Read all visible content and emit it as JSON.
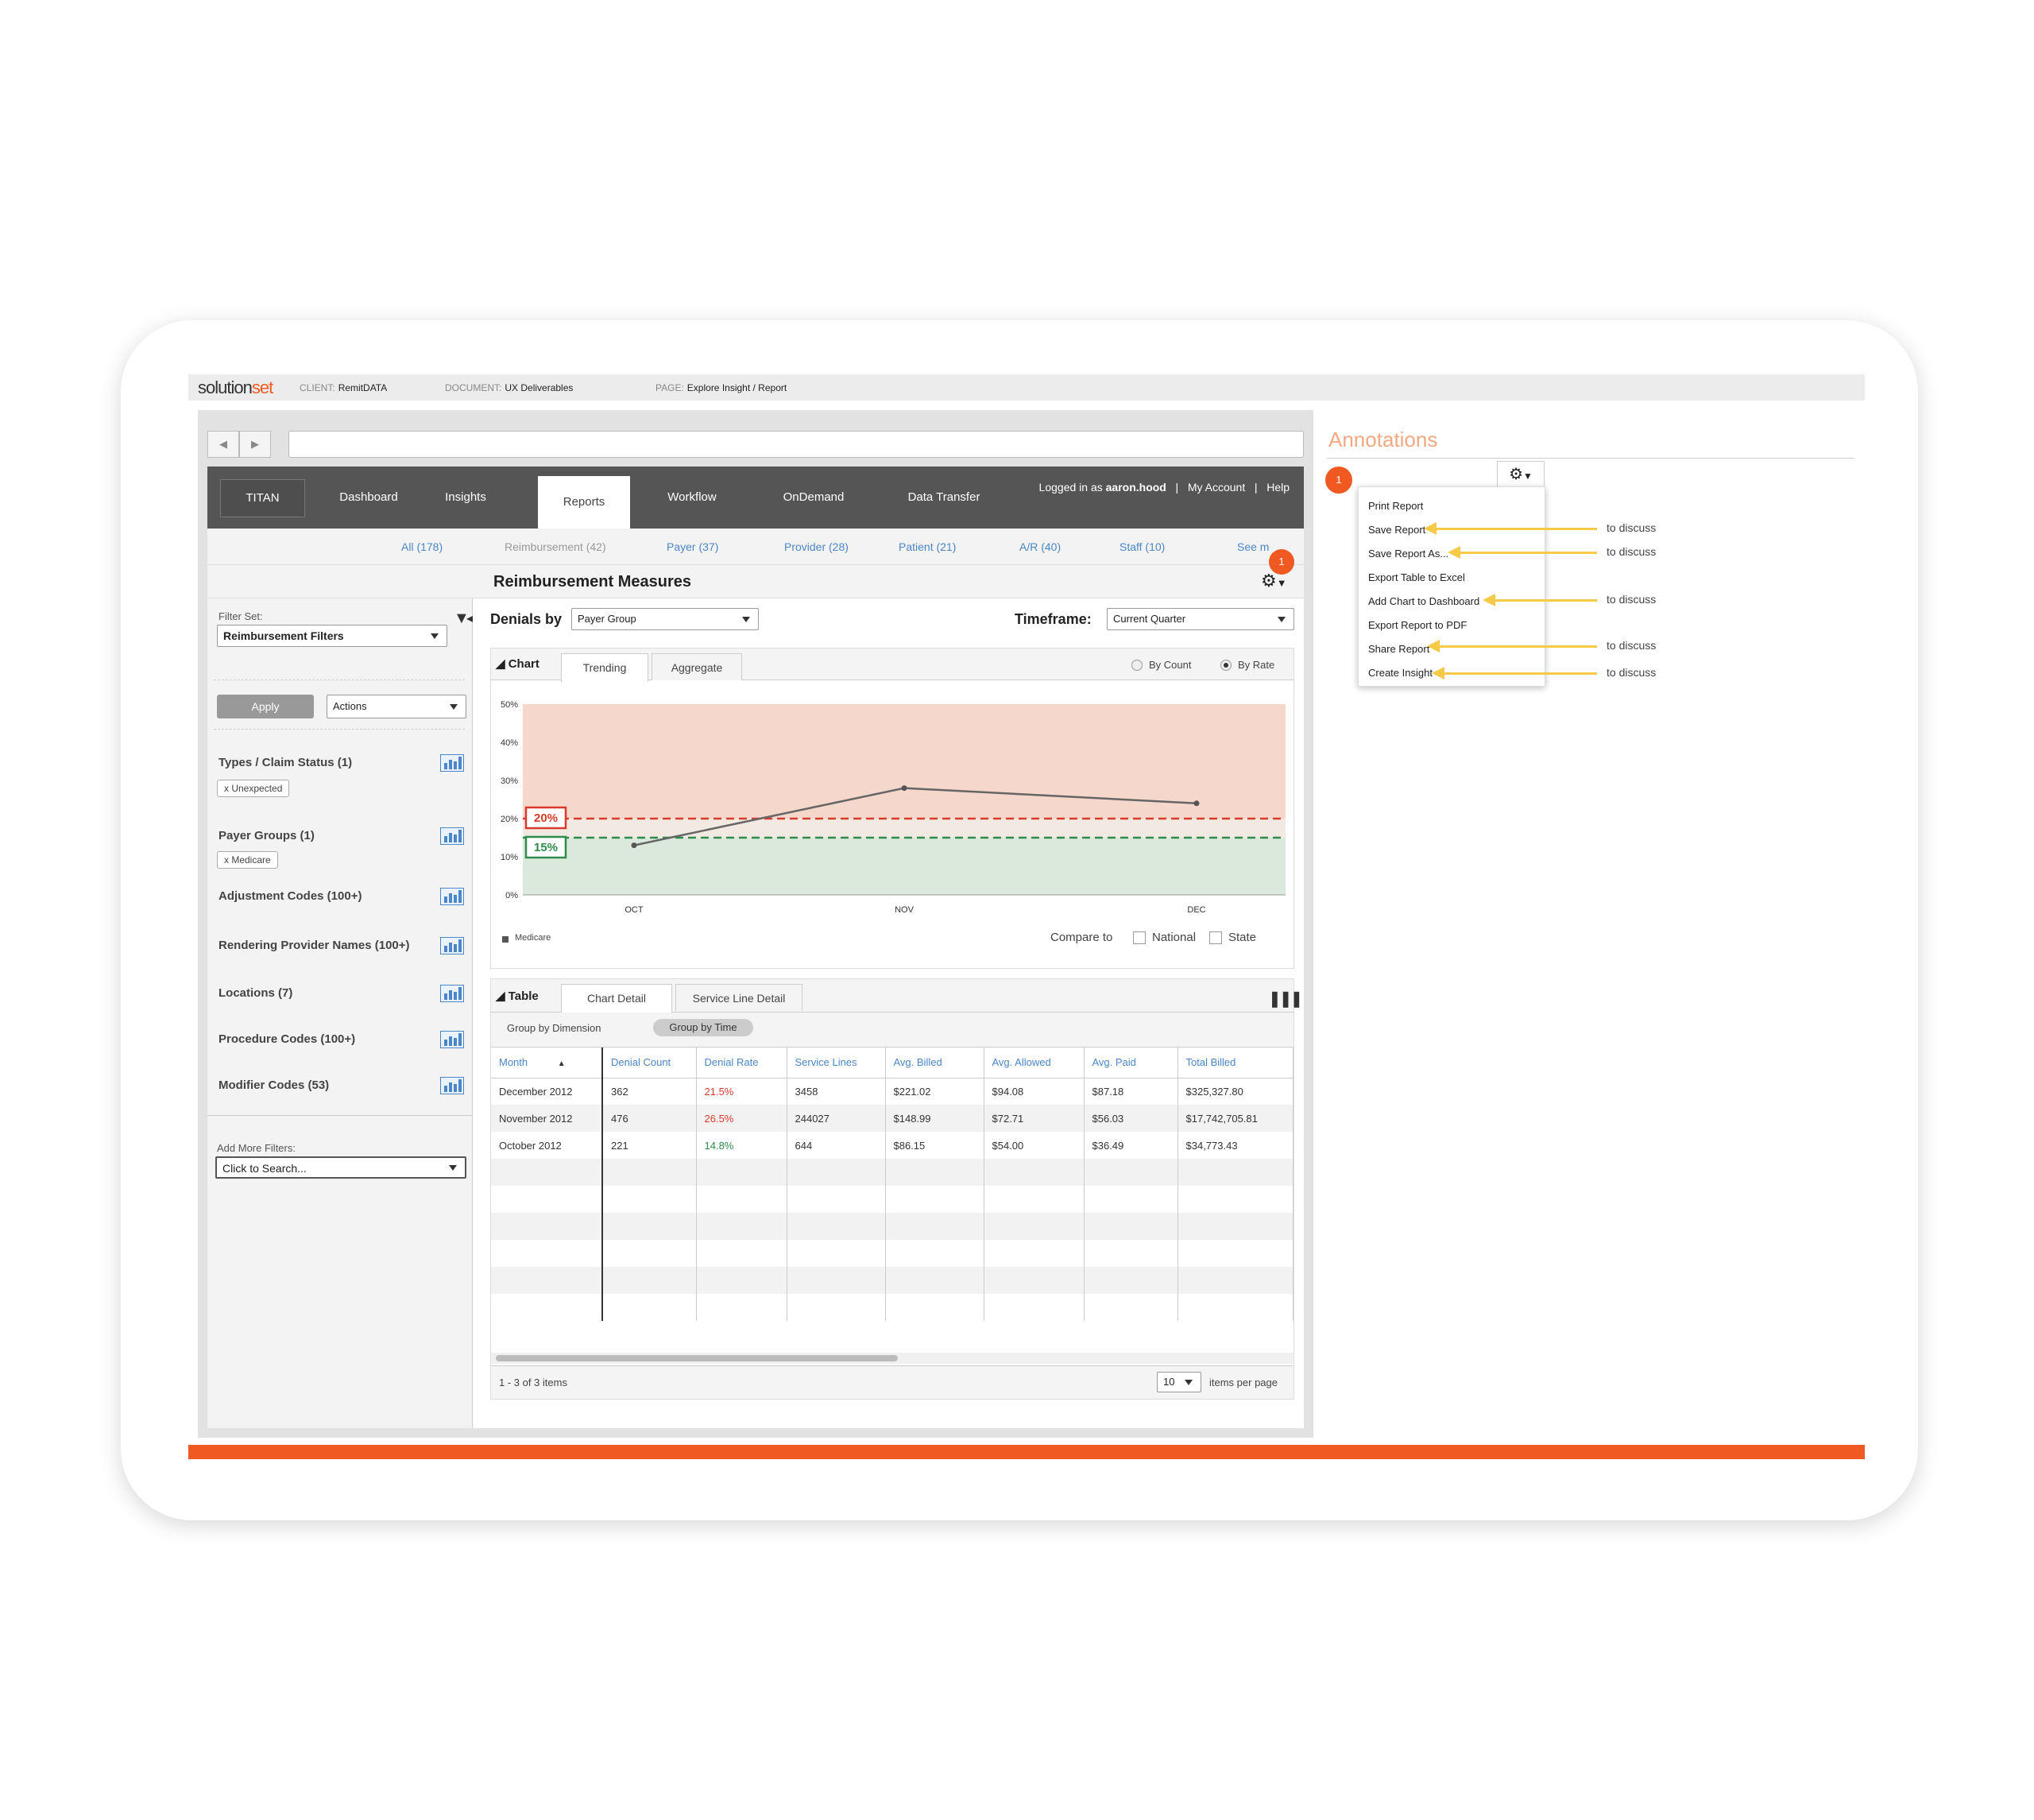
{
  "header": {
    "brand_a": "solution",
    "brand_b": "set",
    "client_key": "CLIENT:",
    "client_val": "RemitDATA",
    "document_key": "DOCUMENT:",
    "document_val": "UX Deliverables",
    "page_key": "PAGE:",
    "page_val": "Explore Insight / Report"
  },
  "browser": {
    "back": "◀",
    "forward": "▶"
  },
  "nav": {
    "titan": "TITAN",
    "items": [
      "Dashboard",
      "Insights",
      "Reports",
      "Workflow",
      "OnDemand",
      "Data Transfer"
    ],
    "active": "Reports",
    "logged_prefix": "Logged in as",
    "user": "aaron.hood",
    "sep": "|",
    "my_account": "My Account",
    "help": "Help"
  },
  "subnav": [
    "All (178)",
    "Reimbursement (42)",
    "Payer (37)",
    "Provider (28)",
    "Patient (21)",
    "A/R (40)",
    "Staff (10)",
    "See m"
  ],
  "page_title": "Reimbursement Measures",
  "badge_count": "1",
  "sidebar": {
    "filter_set_label": "Filter Set:",
    "filter_set_value": "Reimbursement Filters",
    "apply": "Apply",
    "actions": "Actions",
    "groups": [
      {
        "label": "Types / Claim Status (1)",
        "chip": "x  Unexpected"
      },
      {
        "label": "Payer Groups  (1)",
        "chip": "x  Medicare"
      },
      {
        "label": "Adjustment Codes (100+)",
        "chip": ""
      },
      {
        "label": "Rendering Provider Names (100+)",
        "chip": ""
      },
      {
        "label": "Locations (7)",
        "chip": ""
      },
      {
        "label": "Procedure Codes (100+)",
        "chip": ""
      },
      {
        "label": "Modifier Codes (53)",
        "chip": ""
      }
    ],
    "add_more_label": "Add More Filters:",
    "search_placeholder": "Click to Search..."
  },
  "controls": {
    "denials_label": "Denials by",
    "denials_value": "Payer Group",
    "timeframe_label": "Timeframe:",
    "timeframe_value": "Current Quarter"
  },
  "chart_panel": {
    "title": "Chart",
    "tabs": [
      "Trending",
      "Aggregate"
    ],
    "by_count": "By Count",
    "by_rate": "By Rate",
    "compare_to": "Compare to",
    "national": "National",
    "state": "State"
  },
  "chart_data": {
    "type": "line",
    "categories": [
      "OCT",
      "NOV",
      "DEC"
    ],
    "series": [
      {
        "name": "Medicare",
        "values": [
          13,
          28,
          24
        ]
      }
    ],
    "ylim": [
      0,
      50
    ],
    "yticks": [
      "0%",
      "10%",
      "20%",
      "30%",
      "40%",
      "50%"
    ],
    "thresholds": [
      {
        "label": "20%",
        "value": 20,
        "color": "#d93a2b"
      },
      {
        "label": "15%",
        "value": 15,
        "color": "#2e8b4a"
      }
    ],
    "band_colors": {
      "upper": "#f5d7cb",
      "lower": "#dbe9dc"
    }
  },
  "table_panel": {
    "title": "Table",
    "tabs": [
      "Chart Detail",
      "Service Line Detail"
    ],
    "group_dimension": "Group by Dimension",
    "group_time": "Group by Time",
    "columns": [
      "Month",
      "Denial Count",
      "Denial Rate",
      "Service Lines",
      "Avg. Billed",
      "Avg. Allowed",
      "Avg. Paid",
      "Total Billed"
    ],
    "rows": [
      [
        "December 2012",
        "362",
        "21.5%",
        "3458",
        "$221.02",
        "$94.08",
        "$87.18",
        "$325,327.80"
      ],
      [
        "November 2012",
        "476",
        "26.5%",
        "244027",
        "$148.99",
        "$72.71",
        "$56.03",
        "$17,742,705.81"
      ],
      [
        "October 2012",
        "221",
        "14.8%",
        "644",
        "$86.15",
        "$54.00",
        "$36.49",
        "$34,773.43"
      ]
    ],
    "rate_colors": [
      "#d93a2b",
      "#d93a2b",
      "#2e8b4a"
    ],
    "footer_count": "1 - 3 of 3 items",
    "per_page": "10",
    "per_page_label": "items per page"
  },
  "annotations": {
    "title": "Annotations",
    "badge": "1",
    "menu": [
      "Print Report",
      "Save Report",
      "Save Report As...",
      "Export Table to Excel",
      "Add Chart to Dashboard",
      "Export Report to PDF",
      "Share Report",
      "Create Insight"
    ],
    "notes": [
      "to discuss",
      "to discuss",
      "to discuss",
      "to discuss",
      "to discuss"
    ]
  }
}
